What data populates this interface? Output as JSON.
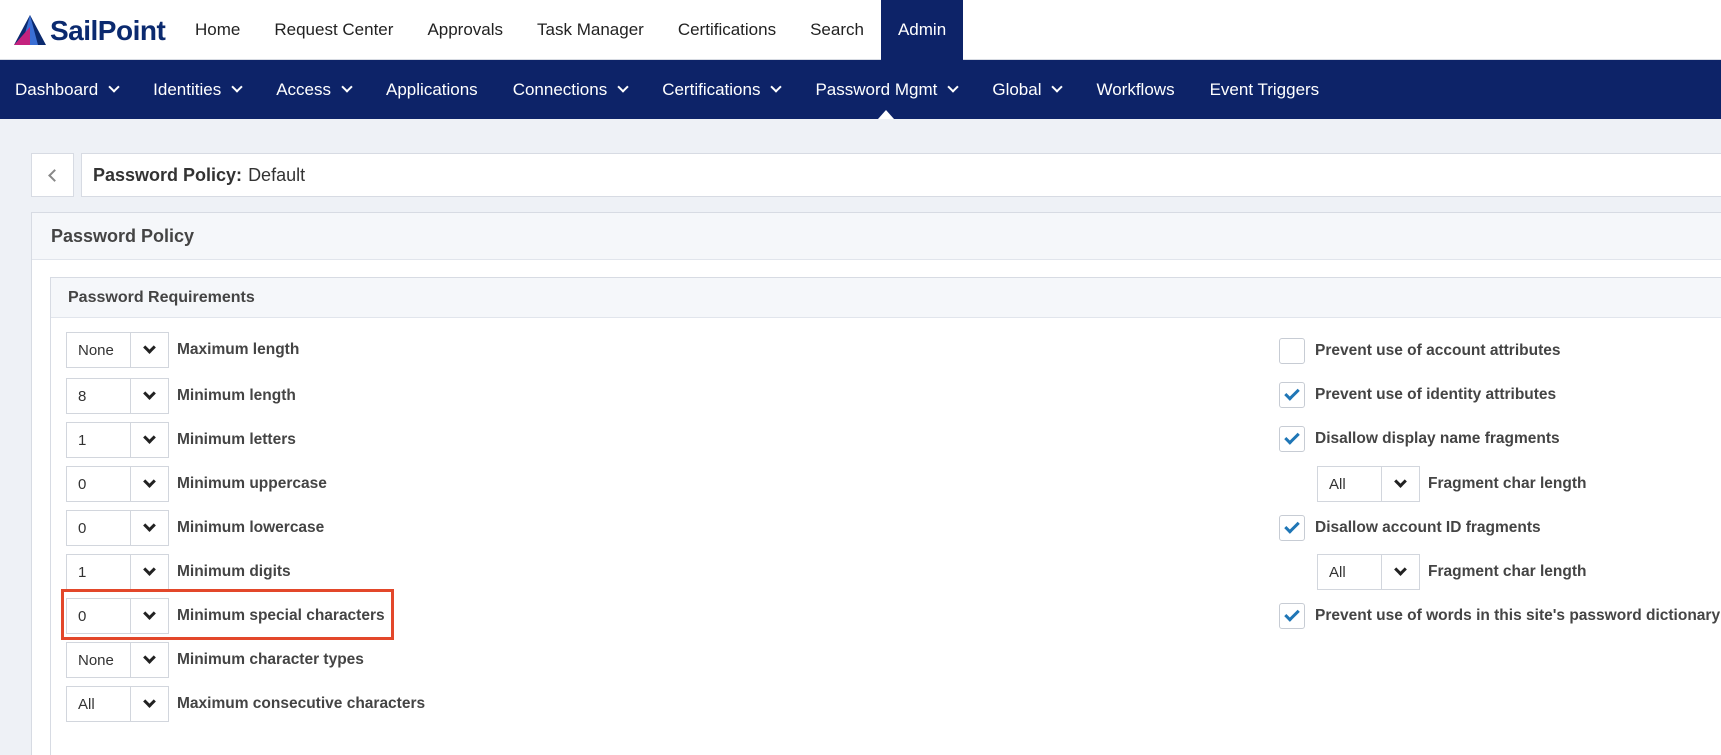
{
  "brand": {
    "logo_text": "SailPoint"
  },
  "topnav": [
    {
      "label": "Home",
      "active": false
    },
    {
      "label": "Request Center",
      "active": false
    },
    {
      "label": "Approvals",
      "active": false
    },
    {
      "label": "Task Manager",
      "active": false
    },
    {
      "label": "Certifications",
      "active": false
    },
    {
      "label": "Search",
      "active": false
    },
    {
      "label": "Admin",
      "active": true
    }
  ],
  "subnav": [
    {
      "label": "Dashboard",
      "dropdown": true
    },
    {
      "label": "Identities",
      "dropdown": true
    },
    {
      "label": "Access",
      "dropdown": true
    },
    {
      "label": "Applications",
      "dropdown": false
    },
    {
      "label": "Connections",
      "dropdown": true
    },
    {
      "label": "Certifications",
      "dropdown": true
    },
    {
      "label": "Password Mgmt",
      "dropdown": true,
      "active": true
    },
    {
      "label": "Global",
      "dropdown": true
    },
    {
      "label": "Workflows",
      "dropdown": false
    },
    {
      "label": "Event Triggers",
      "dropdown": false
    }
  ],
  "breadcrumb": {
    "label": "Password Policy:",
    "value": "Default"
  },
  "panel": {
    "title": "Password Policy"
  },
  "requirements": {
    "title": "Password Requirements",
    "left": [
      {
        "value": "None",
        "label": "Maximum length"
      },
      {
        "value": "8",
        "label": "Minimum length"
      },
      {
        "value": "1",
        "label": "Minimum letters"
      },
      {
        "value": "0",
        "label": "Minimum uppercase"
      },
      {
        "value": "0",
        "label": "Minimum lowercase"
      },
      {
        "value": "1",
        "label": "Minimum digits"
      },
      {
        "value": "0",
        "label": "Minimum special characters"
      },
      {
        "value": "None",
        "label": "Minimum character types"
      },
      {
        "value": "All",
        "label": "Maximum consecutive characters"
      }
    ],
    "right": [
      {
        "type": "checkbox",
        "checked": false,
        "label": "Prevent use of account attributes"
      },
      {
        "type": "checkbox",
        "checked": true,
        "label": "Prevent use of identity attributes"
      },
      {
        "type": "checkbox",
        "checked": true,
        "label": "Disallow display name fragments"
      },
      {
        "type": "select",
        "value": "All",
        "label": "Fragment char length"
      },
      {
        "type": "checkbox",
        "checked": true,
        "label": "Disallow account ID fragments"
      },
      {
        "type": "select",
        "value": "All",
        "label": "Fragment char length"
      },
      {
        "type": "checkbox",
        "checked": true,
        "label": "Prevent use of words in this site's password dictionary"
      }
    ]
  },
  "colors": {
    "navy": "#0d2368",
    "highlight": "#e3472a",
    "check": "#1f76b6"
  }
}
